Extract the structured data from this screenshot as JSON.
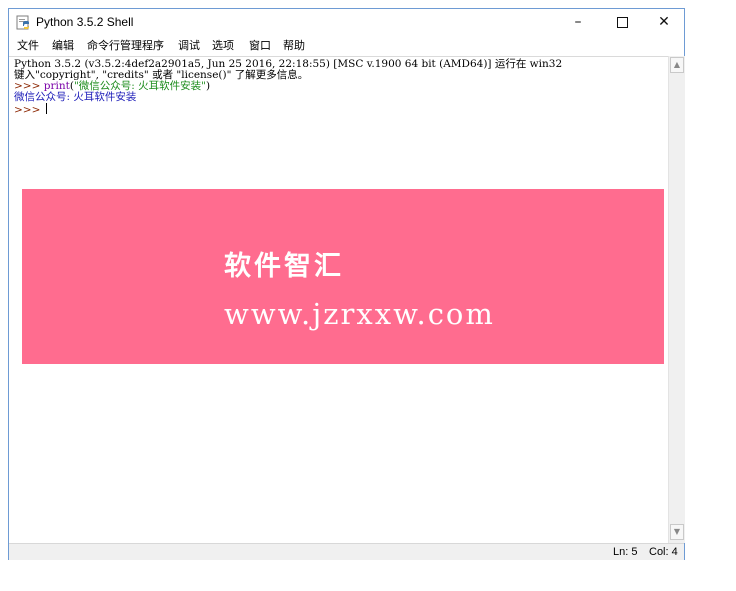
{
  "window": {
    "title": "Python 3.5.2 Shell",
    "controls": {
      "minimize": "–",
      "close": "✕"
    }
  },
  "menu": {
    "items": [
      "文件",
      "编辑",
      "命令行管理程序",
      "调试",
      "选项",
      "窗口",
      "帮助"
    ]
  },
  "shell": {
    "banner_line1": "Python 3.5.2 (v3.5.2:4def2a2901a5, Jun 25 2016, 22:18:55) [MSC v.1900 64 bit (AMD64)] 运行在 win32",
    "banner_line2": "键入\"copyright\", \"credits\" 或者 \"license()\" 了解更多信息。",
    "prompt": ">>> ",
    "command_keyword": "print",
    "command_open": "(",
    "command_string": "\"微信公众号: 火耳软件安装\"",
    "command_close": ")",
    "output": "微信公众号: 火耳软件安装"
  },
  "status": {
    "line": "Ln: 5",
    "column": "Col: 4"
  },
  "overlay": {
    "title": "软件智汇",
    "url": "www.jzrxxw.com",
    "color": "#ff6c8f"
  },
  "icons": {
    "app": "python-idle-icon",
    "scroll_up": "▲",
    "scroll_down": "▼"
  }
}
